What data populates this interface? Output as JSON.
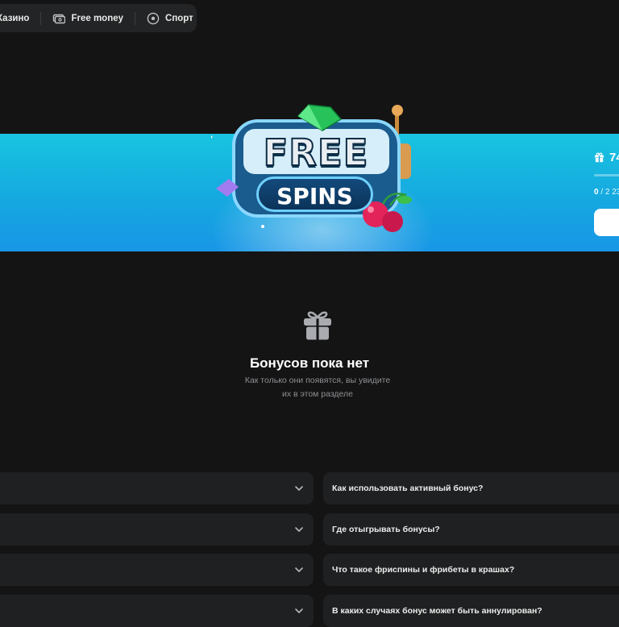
{
  "nav": {
    "items": [
      {
        "label": "Казино",
        "icon": "casino-icon"
      },
      {
        "label": "Free money",
        "icon": "free-money-icon"
      },
      {
        "label": "Спорт",
        "icon": "football-icon"
      }
    ]
  },
  "banner": {
    "art_text_top": "FREE",
    "art_text_bottom": "SPINS",
    "gift_count": "74",
    "progress": {
      "current": "0",
      "total_text": "/ 2 23",
      "fraction": 0.0
    },
    "colors": {
      "from": "#19c4e0",
      "to": "#1896e6"
    }
  },
  "empty": {
    "title": "Бонусов пока нет",
    "subtitle_line1": "Как только они появятся, вы увидите",
    "subtitle_line2": "их в этом разделе"
  },
  "faq": {
    "left": [
      {
        "question": ""
      },
      {
        "question": ""
      },
      {
        "question": ""
      },
      {
        "question": ""
      }
    ],
    "right": [
      {
        "question": "Как использовать активный бонус?"
      },
      {
        "question": "Где отыгрывать бонусы?"
      },
      {
        "question": "Что такое фриспины и фрибеты в крашах?"
      },
      {
        "question": "В каких случаях бонус может быть аннулирован?"
      }
    ]
  }
}
